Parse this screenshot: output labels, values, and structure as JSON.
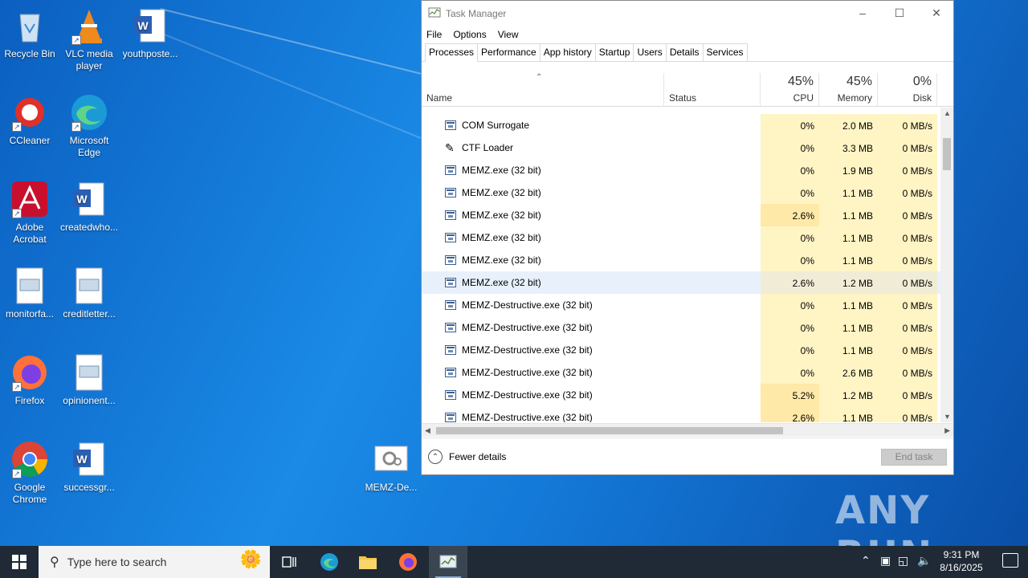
{
  "desktop": {
    "icons": [
      {
        "label": "Recycle Bin",
        "icon": "recycle-bin-icon"
      },
      {
        "label": "VLC media player",
        "icon": "vlc-icon"
      },
      {
        "label": "youthposte...",
        "icon": "word-doc-icon"
      },
      {
        "label": "CCleaner",
        "icon": "ccleaner-icon"
      },
      {
        "label": "Microsoft Edge",
        "icon": "edge-icon"
      },
      {
        "label": "Adobe Acrobat",
        "icon": "acrobat-icon"
      },
      {
        "label": "createdwho...",
        "icon": "word-doc-icon"
      },
      {
        "label": "monitorfa...",
        "icon": "image-file-icon"
      },
      {
        "label": "creditletter...",
        "icon": "image-file-icon"
      },
      {
        "label": "Firefox",
        "icon": "firefox-icon"
      },
      {
        "label": "opinionent...",
        "icon": "image-file-icon"
      },
      {
        "label": "Google Chrome",
        "icon": "chrome-icon"
      },
      {
        "label": "successgr...",
        "icon": "word-doc-icon"
      },
      {
        "label": "MEMZ-De...",
        "icon": "settings-file-icon"
      }
    ],
    "watermark": "ANY RUN"
  },
  "taskmanager": {
    "title": "Task Manager",
    "menu": [
      "File",
      "Options",
      "View"
    ],
    "tabs": [
      "Processes",
      "Performance",
      "App history",
      "Startup",
      "Users",
      "Details",
      "Services"
    ],
    "active_tab": "Processes",
    "columns": {
      "name": "Name",
      "status": "Status",
      "cpu": {
        "label": "CPU",
        "pct": "45%"
      },
      "memory": {
        "label": "Memory",
        "pct": "45%"
      },
      "disk": {
        "label": "Disk",
        "pct": "0%"
      }
    },
    "rows": [
      {
        "name": "COM Surrogate",
        "cpu": "0%",
        "memory": "2.0 MB",
        "disk": "0 MB/s",
        "icon": "process-window-icon"
      },
      {
        "name": "CTF Loader",
        "cpu": "0%",
        "memory": "3.3 MB",
        "disk": "0 MB/s",
        "icon": "ctf-pen-icon"
      },
      {
        "name": "MEMZ.exe (32 bit)",
        "cpu": "0%",
        "memory": "1.9 MB",
        "disk": "0 MB/s",
        "icon": "process-window-icon"
      },
      {
        "name": "MEMZ.exe (32 bit)",
        "cpu": "0%",
        "memory": "1.1 MB",
        "disk": "0 MB/s",
        "icon": "process-window-icon"
      },
      {
        "name": "MEMZ.exe (32 bit)",
        "cpu": "2.6%",
        "memory": "1.1 MB",
        "disk": "0 MB/s",
        "icon": "process-window-icon"
      },
      {
        "name": "MEMZ.exe (32 bit)",
        "cpu": "0%",
        "memory": "1.1 MB",
        "disk": "0 MB/s",
        "icon": "process-window-icon"
      },
      {
        "name": "MEMZ.exe (32 bit)",
        "cpu": "0%",
        "memory": "1.1 MB",
        "disk": "0 MB/s",
        "icon": "process-window-icon"
      },
      {
        "name": "MEMZ.exe (32 bit)",
        "cpu": "2.6%",
        "memory": "1.2 MB",
        "disk": "0 MB/s",
        "icon": "process-window-icon",
        "selected": true
      },
      {
        "name": "MEMZ-Destructive.exe (32 bit)",
        "cpu": "0%",
        "memory": "1.1 MB",
        "disk": "0 MB/s",
        "icon": "process-window-icon"
      },
      {
        "name": "MEMZ-Destructive.exe (32 bit)",
        "cpu": "0%",
        "memory": "1.1 MB",
        "disk": "0 MB/s",
        "icon": "process-window-icon"
      },
      {
        "name": "MEMZ-Destructive.exe (32 bit)",
        "cpu": "0%",
        "memory": "1.1 MB",
        "disk": "0 MB/s",
        "icon": "process-window-icon"
      },
      {
        "name": "MEMZ-Destructive.exe (32 bit)",
        "cpu": "0%",
        "memory": "2.6 MB",
        "disk": "0 MB/s",
        "icon": "process-window-icon"
      },
      {
        "name": "MEMZ-Destructive.exe (32 bit)",
        "cpu": "5.2%",
        "memory": "1.2 MB",
        "disk": "0 MB/s",
        "icon": "process-window-icon"
      },
      {
        "name": "MEMZ-Destructive.exe (32 bit)",
        "cpu": "2.6%",
        "memory": "1.1 MB",
        "disk": "0 MB/s",
        "icon": "process-window-icon"
      }
    ],
    "fewer_details": "Fewer details",
    "end_task": "End task",
    "colors": {
      "heat_low": "#fff4c4",
      "heat_mid": "#ffe9a8",
      "selected": "#e8f1fb"
    }
  },
  "taskbar": {
    "search_placeholder": "Type here to search",
    "time": "9:31 PM",
    "date": "8/16/2025"
  }
}
